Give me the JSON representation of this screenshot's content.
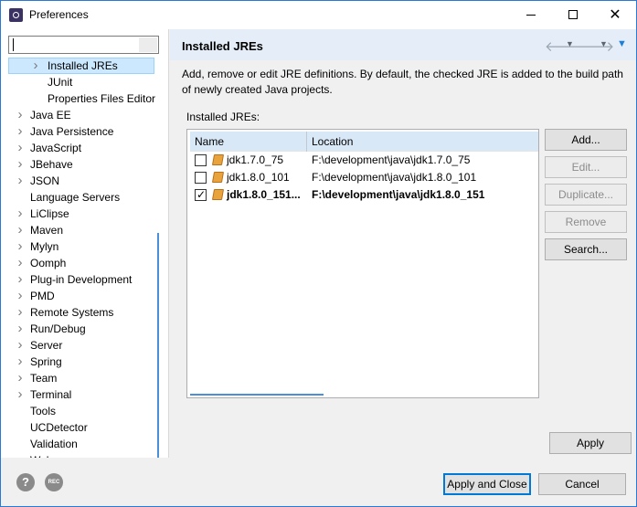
{
  "window": {
    "title": "Preferences",
    "minimize_glyph": "",
    "maximize_glyph": "",
    "close_glyph": "✕"
  },
  "sidebar": {
    "filter_value": "",
    "items": [
      {
        "label": "Installed JREs",
        "expanded": false,
        "has_arrow": true,
        "depth": 1,
        "selected": true
      },
      {
        "label": "JUnit",
        "has_arrow": false,
        "depth": 2
      },
      {
        "label": "Properties Files Editor",
        "has_arrow": false,
        "depth": 2
      },
      {
        "label": "Java EE",
        "has_arrow": true,
        "depth": 0
      },
      {
        "label": "Java Persistence",
        "has_arrow": true,
        "depth": 0
      },
      {
        "label": "JavaScript",
        "has_arrow": true,
        "depth": 0
      },
      {
        "label": "JBehave",
        "has_arrow": true,
        "depth": 0
      },
      {
        "label": "JSON",
        "has_arrow": true,
        "depth": 0
      },
      {
        "label": "Language Servers",
        "has_arrow": false,
        "depth": 0
      },
      {
        "label": "LiClipse",
        "has_arrow": true,
        "depth": 0
      },
      {
        "label": "Maven",
        "has_arrow": true,
        "depth": 0
      },
      {
        "label": "Mylyn",
        "has_arrow": true,
        "depth": 0
      },
      {
        "label": "Oomph",
        "has_arrow": true,
        "depth": 0
      },
      {
        "label": "Plug-in Development",
        "has_arrow": true,
        "depth": 0
      },
      {
        "label": "PMD",
        "has_arrow": true,
        "depth": 0
      },
      {
        "label": "Remote Systems",
        "has_arrow": true,
        "depth": 0
      },
      {
        "label": "Run/Debug",
        "has_arrow": true,
        "depth": 0
      },
      {
        "label": "Server",
        "has_arrow": true,
        "depth": 0
      },
      {
        "label": "Spring",
        "has_arrow": true,
        "depth": 0
      },
      {
        "label": "Team",
        "has_arrow": true,
        "depth": 0
      },
      {
        "label": "Terminal",
        "has_arrow": true,
        "depth": 0
      },
      {
        "label": "Tools",
        "has_arrow": false,
        "depth": 0
      },
      {
        "label": "UCDetector",
        "has_arrow": false,
        "depth": 0
      },
      {
        "label": "Validation",
        "has_arrow": false,
        "depth": 0
      },
      {
        "label": "Web",
        "has_arrow": true,
        "depth": 0
      }
    ]
  },
  "page": {
    "title": "Installed JREs",
    "description": "Add, remove or edit JRE definitions. By default, the checked JRE is added to the build path of newly created Java projects.",
    "list_label": "Installed JREs:",
    "columns": [
      "Name",
      "Location"
    ],
    "rows": [
      {
        "checked": false,
        "name": "jdk1.7.0_75",
        "location": "F:\\development\\java\\jdk1.7.0_75",
        "bold": false
      },
      {
        "checked": false,
        "name": "jdk1.8.0_101",
        "location": "F:\\development\\java\\jdk1.8.0_101",
        "bold": false
      },
      {
        "checked": true,
        "name": "jdk1.8.0_151...",
        "location": "F:\\development\\java\\jdk1.8.0_151",
        "bold": true
      }
    ],
    "buttons": {
      "add": "Add...",
      "edit": "Edit...",
      "duplicate": "Duplicate...",
      "remove": "Remove",
      "search": "Search..."
    },
    "apply": "Apply"
  },
  "footer": {
    "apply_and_close": "Apply and Close",
    "cancel": "Cancel",
    "help_glyph": "?",
    "rec_glyph": "REC"
  },
  "icons": {
    "back": "back-arrow-icon",
    "forward": "forward-arrow-icon",
    "menu": "view-menu-icon"
  },
  "colors": {
    "accent": "#0078d7",
    "header_bg": "#e5eef8",
    "selection": "#cce8ff",
    "jre_icon": "#e8a33c"
  }
}
